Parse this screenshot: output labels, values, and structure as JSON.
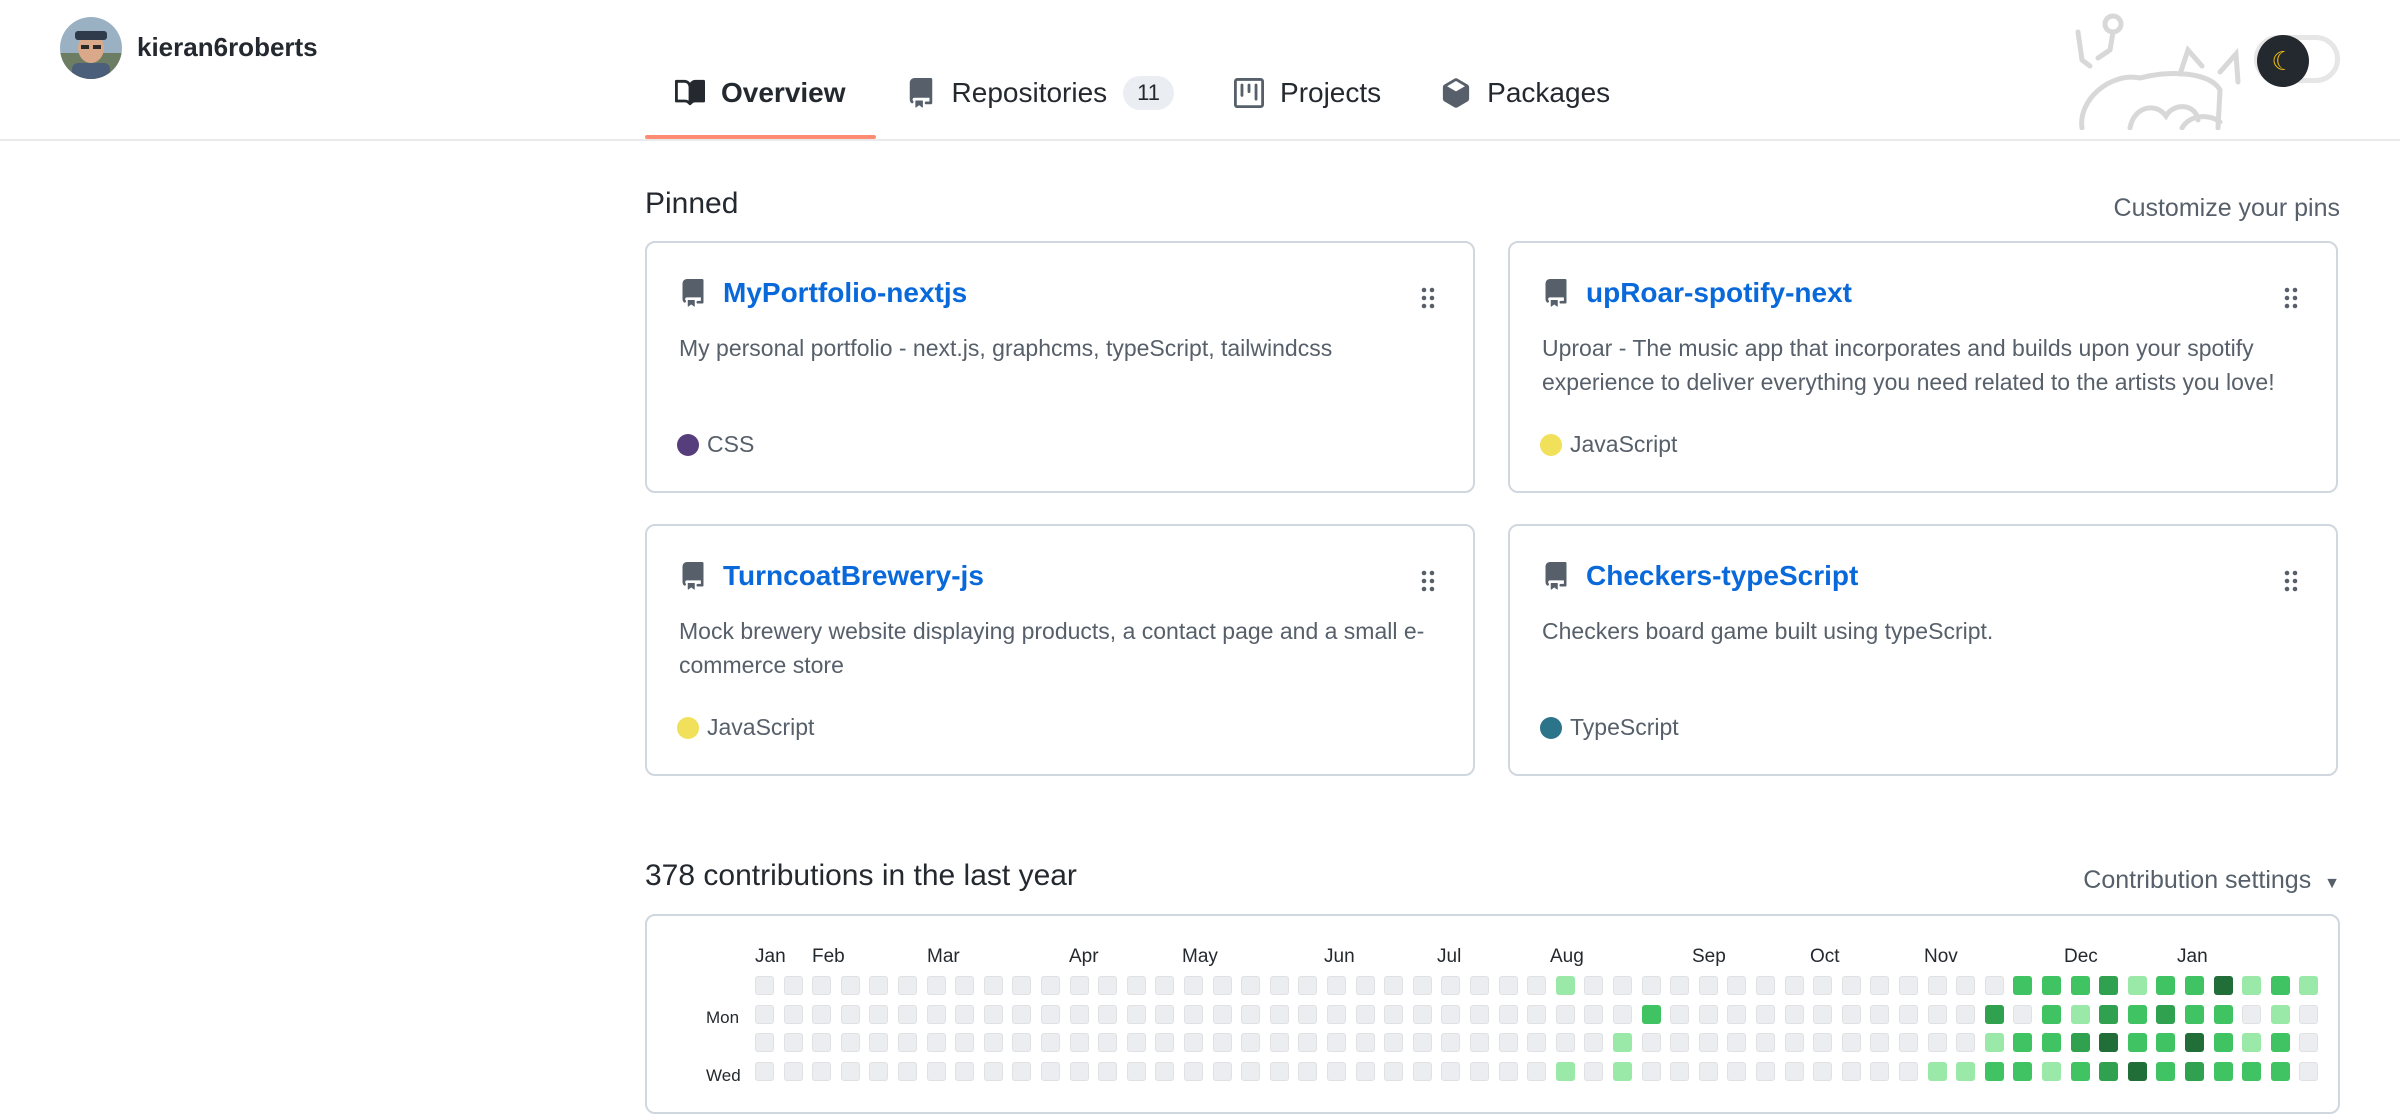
{
  "user": {
    "username": "kieran6roberts"
  },
  "tabs": [
    {
      "label": "Overview",
      "icon": "book-icon",
      "active": true
    },
    {
      "label": "Repositories",
      "icon": "repo-icon",
      "count": "11"
    },
    {
      "label": "Projects",
      "icon": "project-icon"
    },
    {
      "label": "Packages",
      "icon": "package-icon"
    }
  ],
  "theme_toggle": {
    "icon": "moon-icon"
  },
  "pinned": {
    "title": "Pinned",
    "customize_label": "Customize your pins",
    "repos": [
      {
        "name": "MyPortfolio-nextjs",
        "description": "My personal portfolio - next.js, graphcms, typeScript, tailwindcss",
        "language": "CSS",
        "language_color": "#563d7c"
      },
      {
        "name": "upRoar-spotify-next",
        "description": "Uproar - The music app that incorporates and builds upon your spotify experience to deliver everything you need related to the artists you love!",
        "language": "JavaScript",
        "language_color": "#f1e05a"
      },
      {
        "name": "TurncoatBrewery-js",
        "description": "Mock brewery website displaying products, a contact page and a small e-commerce store",
        "language": "JavaScript",
        "language_color": "#f1e05a"
      },
      {
        "name": "Checkers-typeScript",
        "description": "Checkers board game built using typeScript.",
        "language": "TypeScript",
        "language_color": "#2b7489"
      }
    ]
  },
  "contributions": {
    "title": "378 contributions in the last year",
    "settings_label": "Contribution settings",
    "months": [
      "Jan",
      "Feb",
      "Mar",
      "Apr",
      "May",
      "Jun",
      "Jul",
      "Aug",
      "Sep",
      "Oct",
      "Nov",
      "Dec",
      "Jan"
    ],
    "day_labels": [
      "Mon",
      "Wed"
    ],
    "colors": [
      "#ebedf0",
      "#9be9a8",
      "#40c463",
      "#30a14e",
      "#216e39"
    ],
    "weeks": [
      [
        0,
        0,
        0,
        0
      ],
      [
        0,
        0,
        0,
        0
      ],
      [
        0,
        0,
        0,
        0
      ],
      [
        0,
        0,
        0,
        0
      ],
      [
        0,
        0,
        0,
        0
      ],
      [
        0,
        0,
        0,
        0
      ],
      [
        0,
        0,
        0,
        0
      ],
      [
        0,
        0,
        0,
        0
      ],
      [
        0,
        0,
        0,
        0
      ],
      [
        0,
        0,
        0,
        0
      ],
      [
        0,
        0,
        0,
        0
      ],
      [
        0,
        0,
        0,
        0
      ],
      [
        0,
        0,
        0,
        0
      ],
      [
        0,
        0,
        0,
        0
      ],
      [
        0,
        0,
        0,
        0
      ],
      [
        0,
        0,
        0,
        0
      ],
      [
        0,
        0,
        0,
        0
      ],
      [
        0,
        0,
        0,
        0
      ],
      [
        0,
        0,
        0,
        0
      ],
      [
        0,
        0,
        0,
        0
      ],
      [
        0,
        0,
        0,
        0
      ],
      [
        0,
        0,
        0,
        0
      ],
      [
        0,
        0,
        0,
        0
      ],
      [
        0,
        0,
        0,
        0
      ],
      [
        0,
        0,
        0,
        0
      ],
      [
        0,
        0,
        0,
        0
      ],
      [
        0,
        0,
        0,
        0
      ],
      [
        0,
        0,
        0,
        0
      ],
      [
        1,
        0,
        0,
        1
      ],
      [
        0,
        0,
        0,
        0
      ],
      [
        0,
        0,
        1,
        1
      ],
      [
        0,
        2,
        0,
        0
      ],
      [
        0,
        0,
        0,
        0
      ],
      [
        0,
        0,
        0,
        0
      ],
      [
        0,
        0,
        0,
        0
      ],
      [
        0,
        0,
        0,
        0
      ],
      [
        0,
        0,
        0,
        0
      ],
      [
        0,
        0,
        0,
        0
      ],
      [
        0,
        0,
        0,
        0
      ],
      [
        0,
        0,
        0,
        0
      ],
      [
        0,
        0,
        0,
        0
      ],
      [
        0,
        0,
        0,
        1
      ],
      [
        0,
        0,
        0,
        1
      ],
      [
        0,
        3,
        1,
        2
      ],
      [
        2,
        0,
        2,
        2
      ],
      [
        2,
        2,
        2,
        1
      ],
      [
        2,
        1,
        3,
        2
      ],
      [
        3,
        3,
        4,
        3
      ],
      [
        1,
        2,
        2,
        4
      ],
      [
        2,
        3,
        2,
        2
      ],
      [
        2,
        2,
        4,
        3
      ],
      [
        4,
        2,
        2,
        2
      ],
      [
        1,
        0,
        1,
        2
      ],
      [
        2,
        1,
        2,
        2
      ],
      [
        1,
        0,
        0,
        0
      ]
    ]
  }
}
